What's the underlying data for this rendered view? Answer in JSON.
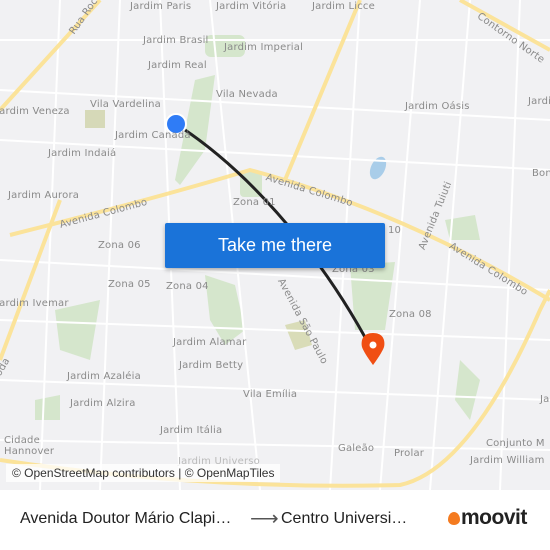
{
  "map": {
    "labels": {
      "jardim_paris": "Jardim Paris",
      "jardim_vitoria": "Jardim Vitória",
      "jardim_licce": "Jardim Licce",
      "rua_rocha": "Rua Roc",
      "contorno_norte": "Contorno Norte",
      "jardim_brasil": "Jardim Brasil",
      "jardim_imperial": "Jardim Imperial",
      "jardim_real": "Jardim Real",
      "vila_nevada": "Vila Nevada",
      "vila_vardelina": "Vila Vardelina",
      "jardim_veneza": "Jardim Veneza",
      "jardim_oasis": "Jardim Oásis",
      "jardim_right": "Jardi",
      "jardim_canada": "Jardim Canadá",
      "jardim_indaia": "Jardim Indaiá",
      "bom": "Bon",
      "jardim_aurora": "Jardim Aurora",
      "avenida_colombo_1": "Avenida Colombo",
      "avenida_colombo_2": "Avenida Colombo",
      "avenida_colombo_3": "Avenida Colombo",
      "zona_01": "Zona 01",
      "avenida_tuiuti": "Avenida Tuiuti",
      "zona_10": "10",
      "zona_06": "Zona 06",
      "zona_05": "Zona 05",
      "zona_04": "Zona 04",
      "zona_03": "Zona 03",
      "zona_08": "Zona 08",
      "jardim_ivemar": "Jardim Ivemar",
      "avenida_sao_paulo": "Avenida São Paulo",
      "jardim_alamar": "Jardim Alamar",
      "jardim_betty": "Jardim Betty",
      "jardim_azaleia": "Jardim Azaléia",
      "vila_emilia": "Vila Emília",
      "jardim_alzira": "Jardim Alzira",
      "jardim_italia": "Jardim Itália",
      "cidade_hannover": "Cidade Hannover",
      "galeao": "Galeão",
      "prolar": "Prolar",
      "conjunto_m": "Conjunto M",
      "jardim_william": "Jardim William",
      "jardim_universo": "Jardim Universo",
      "ja_right": "Ja",
      "oda": "oda"
    },
    "colors": {
      "origin": "#2f7cf6",
      "destination": "#f04e13",
      "route": "#222222",
      "major_road": "#fbe59a",
      "park": "#cfe3c4"
    },
    "attribution": "© OpenStreetMap contributors | © OpenMapTiles"
  },
  "cta": {
    "label": "Take me there",
    "color": "#1a73d9"
  },
  "footer": {
    "origin": "Avenida Doutor Mário Clapier Urbinati",
    "destination": "Centro Universitário",
    "arrow_icon": "arrow-right-icon",
    "logo_text": "moovit"
  }
}
